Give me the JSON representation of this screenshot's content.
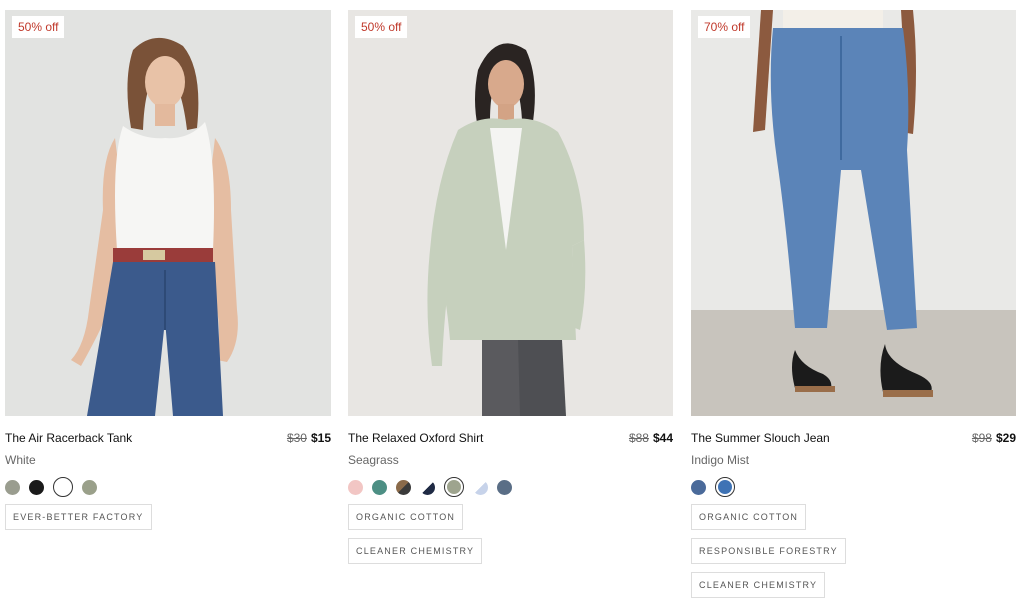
{
  "products": [
    {
      "badge": "50% off",
      "title": "The Air Racerback Tank",
      "old_price": "$30",
      "new_price": "$15",
      "color_name": "White",
      "swatches": [
        {
          "color": "#9a9d8f",
          "selected": false
        },
        {
          "color": "#1a1a1a",
          "selected": false
        },
        {
          "color": "#ffffff",
          "selected": true
        },
        {
          "color": "#9aa08a",
          "selected": false
        }
      ],
      "tags": [
        "EVER-BETTER FACTORY"
      ]
    },
    {
      "badge": "50% off",
      "title": "The Relaxed Oxford Shirt",
      "old_price": "$88",
      "new_price": "$44",
      "color_name": "Seagrass",
      "swatches": [
        {
          "color": "#f2c6c4",
          "selected": false
        },
        {
          "color": "#4d8f84",
          "selected": false
        },
        {
          "color": "#6b5a4a",
          "selected": false
        },
        {
          "color": "#1f2a44",
          "selected": false
        },
        {
          "color": "#9ea48e",
          "selected": true
        },
        {
          "color": "#c7d3ea",
          "selected": false
        },
        {
          "color": "#5a6e86",
          "selected": false
        }
      ],
      "tags": [
        "ORGANIC COTTON",
        "CLEANER CHEMISTRY"
      ]
    },
    {
      "badge": "70% off",
      "title": "The Summer Slouch Jean",
      "old_price": "$98",
      "new_price": "$29",
      "color_name": "Indigo Mist",
      "swatches": [
        {
          "color": "#4a6a9a",
          "selected": false
        },
        {
          "color": "#3f73b5",
          "selected": true
        }
      ],
      "tags": [
        "ORGANIC COTTON",
        "RESPONSIBLE FORESTRY",
        "CLEANER CHEMISTRY"
      ]
    }
  ]
}
